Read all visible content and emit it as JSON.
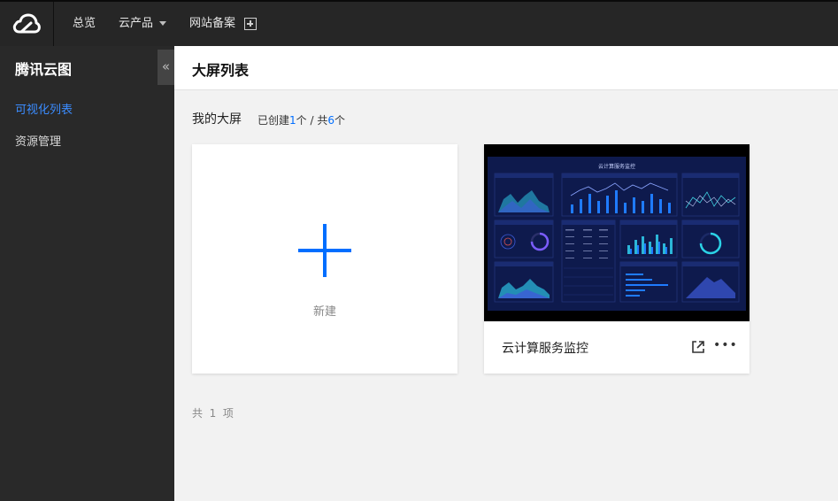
{
  "nav": {
    "items": [
      {
        "label": "总览"
      },
      {
        "label": "云产品"
      },
      {
        "label": "网站备案"
      }
    ]
  },
  "sidebar": {
    "title": "腾讯云图",
    "collapse_glyph": "«",
    "items": [
      {
        "label": "可视化列表",
        "active": true
      },
      {
        "label": "资源管理",
        "active": false
      }
    ]
  },
  "header": {
    "title": "大屏列表"
  },
  "section": {
    "title": "我的大屏",
    "created_prefix": "已创建",
    "created_count": "1",
    "created_unit": "个 / 共",
    "total_count": "6",
    "total_unit": "个"
  },
  "cards": {
    "new_label": "新建",
    "screens": [
      {
        "name": "云计算服务监控",
        "thumbnail_title": "云计算服务监控"
      }
    ]
  },
  "footer": {
    "total_text": "共  1  项"
  },
  "colors": {
    "accent": "#006eff",
    "topbar": "#262626",
    "sidebar": "#292929",
    "dashboard_bg": "#0e1a4d"
  }
}
